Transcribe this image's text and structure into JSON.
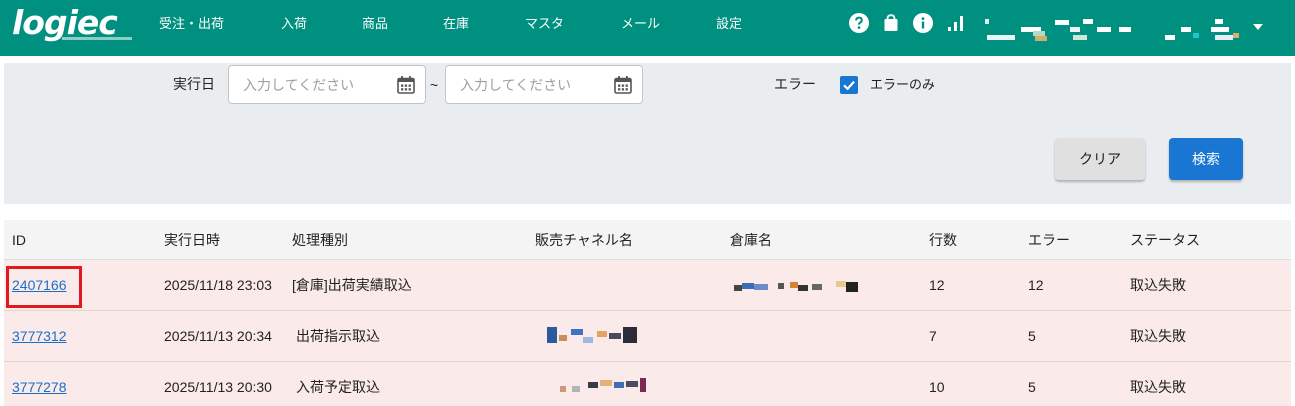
{
  "app": {
    "logo_text": "logiec"
  },
  "nav": {
    "items": [
      "受注・出荷",
      "入荷",
      "商品",
      "在庫",
      "マスタ",
      "メール",
      "設定"
    ],
    "icons": [
      "help-icon",
      "bag-icon",
      "info-icon",
      "signal-icon"
    ]
  },
  "search": {
    "date_label": "実行日",
    "date_from_placeholder": "入力してください",
    "date_to_placeholder": "入力してください",
    "range_separator": "~",
    "error_label": "エラー",
    "error_only_label": "エラーのみ",
    "error_only_checked": true,
    "clear_label": "クリア",
    "search_label": "検索"
  },
  "table": {
    "columns": [
      "ID",
      "実行日時",
      "処理種別",
      "販売チャネル名",
      "倉庫名",
      "行数",
      "エラー",
      "ステータス"
    ],
    "rows": [
      {
        "id": "2407166",
        "datetime": "2025/11/18 23:03",
        "type": "[倉庫]出荷実績取込",
        "lines": "12",
        "errors": "12",
        "status": "取込失敗"
      },
      {
        "id": "3777312",
        "datetime": "2025/11/13 20:34",
        "type": "出荷指示取込",
        "lines": "7",
        "errors": "5",
        "status": "取込失敗"
      },
      {
        "id": "3777278",
        "datetime": "2025/11/13 20:30",
        "type": "入荷予定取込",
        "lines": "10",
        "errors": "5",
        "status": "取込失敗"
      }
    ]
  },
  "colors": {
    "header": "#009080",
    "primary": "#1976d2",
    "error_row": "#fbeaea",
    "highlight": "#e0191f"
  }
}
